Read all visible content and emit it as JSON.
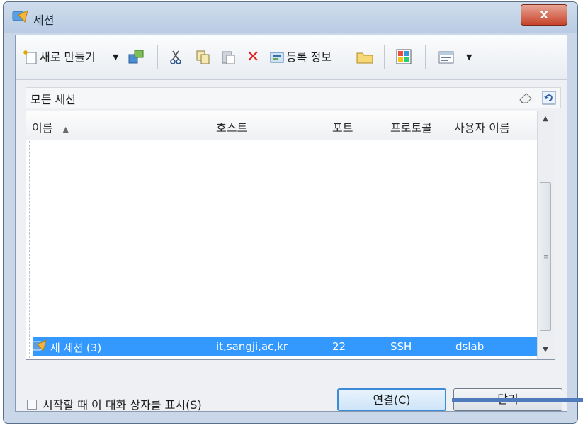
{
  "window": {
    "title": "세션",
    "close_glyph": "x"
  },
  "toolbar": {
    "new_label": "새로 만들기",
    "properties_label": "등록 정보",
    "icons": [
      "new-session-icon",
      "dropdown-arrow-icon",
      "connect-icon",
      "cut-icon",
      "copy-icon",
      "paste-icon",
      "delete-icon",
      "properties-icon",
      "folder-icon",
      "theme-icon",
      "view-icon",
      "view-dropdown-icon"
    ]
  },
  "path": {
    "label": "모든 세션"
  },
  "list": {
    "columns": {
      "name": "이름",
      "host": "호스트",
      "port": "포트",
      "protocol": "프로토콜",
      "user": "사용자 이름"
    },
    "rows": [
      {
        "name": "새 세션 (3)",
        "host": "it,sangji,ac,kr",
        "port": "22",
        "protocol": "SSH",
        "user": "dslab"
      }
    ]
  },
  "footer": {
    "checkbox_label": "시작할 때 이 대화 상자를 표시(S)",
    "connect_label": "연결(C)",
    "close_label": "닫기"
  },
  "colors": {
    "selection": "#3399ff",
    "accent": "#4f7bbd",
    "close_red": "#c7432b"
  }
}
